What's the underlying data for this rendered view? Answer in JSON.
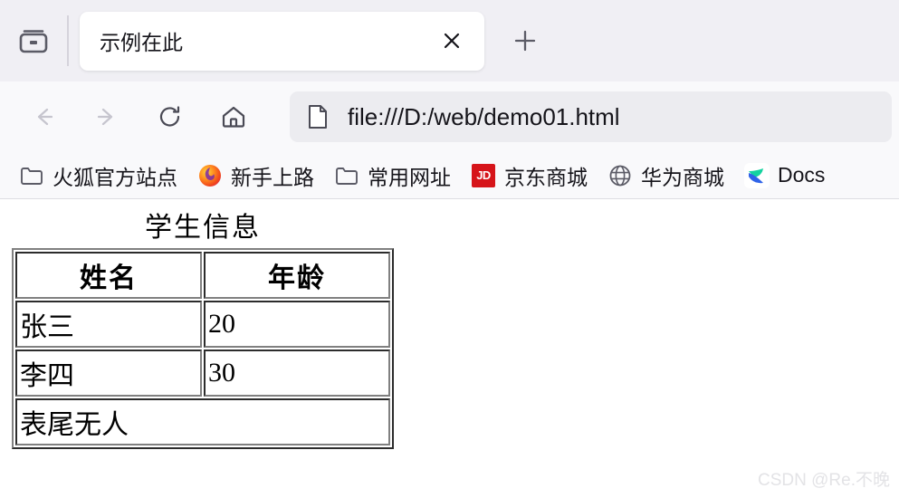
{
  "browser": {
    "tabstrip": {
      "list_all_tabs_icon": "tab-box-icon",
      "tabs": [
        {
          "title": "示例在此",
          "active": true,
          "close_icon": "close-icon"
        }
      ],
      "new_tab_icon": "plus-icon",
      "new_tab_label": "+"
    },
    "toolbar": {
      "back_icon": "arrow-left-icon",
      "forward_icon": "arrow-right-icon",
      "reload_icon": "reload-icon",
      "home_icon": "home-icon",
      "url_icon": "page-document-icon",
      "url": "file:///D:/web/demo01.html"
    },
    "bookmarks": [
      {
        "label": "火狐官方站点",
        "icon": "folder-icon"
      },
      {
        "label": "新手上路",
        "icon": "firefox-logo-icon"
      },
      {
        "label": "常用网址",
        "icon": "folder-icon"
      },
      {
        "label": "京东商城",
        "icon": "jd-icon",
        "icon_text": "JD"
      },
      {
        "label": "华为商城",
        "icon": "globe-icon"
      },
      {
        "label": "Docs",
        "icon": "docs-icon"
      }
    ]
  },
  "page": {
    "table": {
      "caption": "学生信息",
      "headers": [
        "姓名",
        "年龄"
      ],
      "rows": [
        [
          "张三",
          "20"
        ],
        [
          "李四",
          "30"
        ]
      ],
      "footer": "表尾无人"
    },
    "watermark": "CSDN @Re.不晚"
  },
  "colors": {
    "tabstrip_bg": "#f0eff4",
    "toolbar_bg": "#f9f9fb",
    "urlbar_bg": "#ececf0",
    "active_tab_bg": "#ffffff",
    "text": "#15141a",
    "jd_red": "#d6141a",
    "table_border": "#808080",
    "watermark": "#e3e3e6"
  }
}
